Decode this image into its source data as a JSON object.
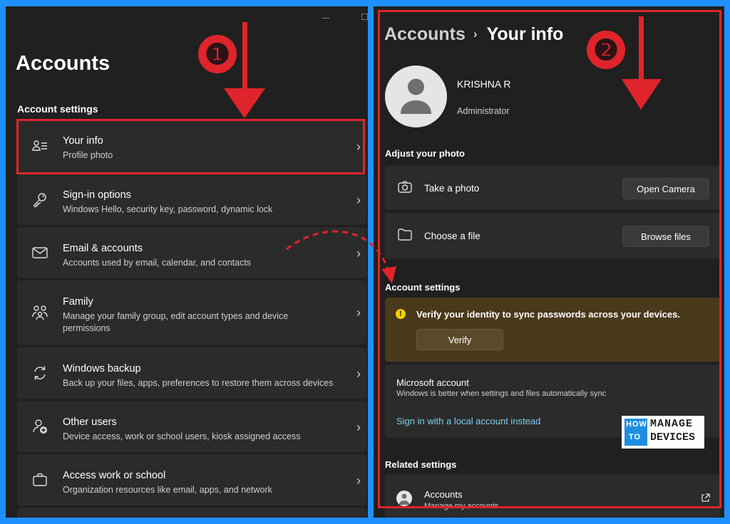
{
  "left": {
    "title": "Accounts",
    "section": "Account settings",
    "items": [
      {
        "title": "Your info",
        "sub": "Profile photo",
        "icon": "person-list-icon"
      },
      {
        "title": "Sign-in options",
        "sub": "Windows Hello, security key, password, dynamic lock",
        "icon": "key-icon"
      },
      {
        "title": "Email & accounts",
        "sub": "Accounts used by email, calendar, and contacts",
        "icon": "mail-icon"
      },
      {
        "title": "Family",
        "sub": "Manage your family group, edit account types and device permissions",
        "icon": "family-icon"
      },
      {
        "title": "Windows backup",
        "sub": "Back up your files, apps, preferences to restore them across devices",
        "icon": "sync-icon"
      },
      {
        "title": "Other users",
        "sub": "Device access, work or school users, kiosk assigned access",
        "icon": "person-add-icon"
      },
      {
        "title": "Access work or school",
        "sub": "Organization resources like email, apps, and network",
        "icon": "briefcase-icon"
      }
    ]
  },
  "right": {
    "crumb_parent": "Accounts",
    "crumb_sep": "›",
    "crumb_current": "Your info",
    "user_name": "KRISHNA R",
    "user_role": "Administrator",
    "adjust_photo_label": "Adjust your photo",
    "take_photo_label": "Take a photo",
    "open_camera_label": "Open Camera",
    "choose_file_label": "Choose a file",
    "browse_files_label": "Browse files",
    "account_settings_label": "Account settings",
    "verify_text": "Verify your identity to sync passwords across your devices.",
    "verify_button": "Verify",
    "ms_account_title": "Microsoft account",
    "ms_account_sub": "Windows is better when settings and files automatically sync",
    "local_link": "Sign in with a local account instead",
    "related_label": "Related settings",
    "accounts_title": "Accounts",
    "accounts_sub": "Manage my accounts"
  },
  "watermark": {
    "how": "HOW",
    "to": "TO",
    "manage": "MANAGE",
    "devices": "DEVICES"
  },
  "annotations": {
    "badge1": "❶",
    "badge2": "❷"
  },
  "colors": {
    "accent_red": "#e0242b",
    "frame_blue": "#1e90ff",
    "link": "#7ad0f0",
    "notice_bg": "#4a3a1c"
  }
}
